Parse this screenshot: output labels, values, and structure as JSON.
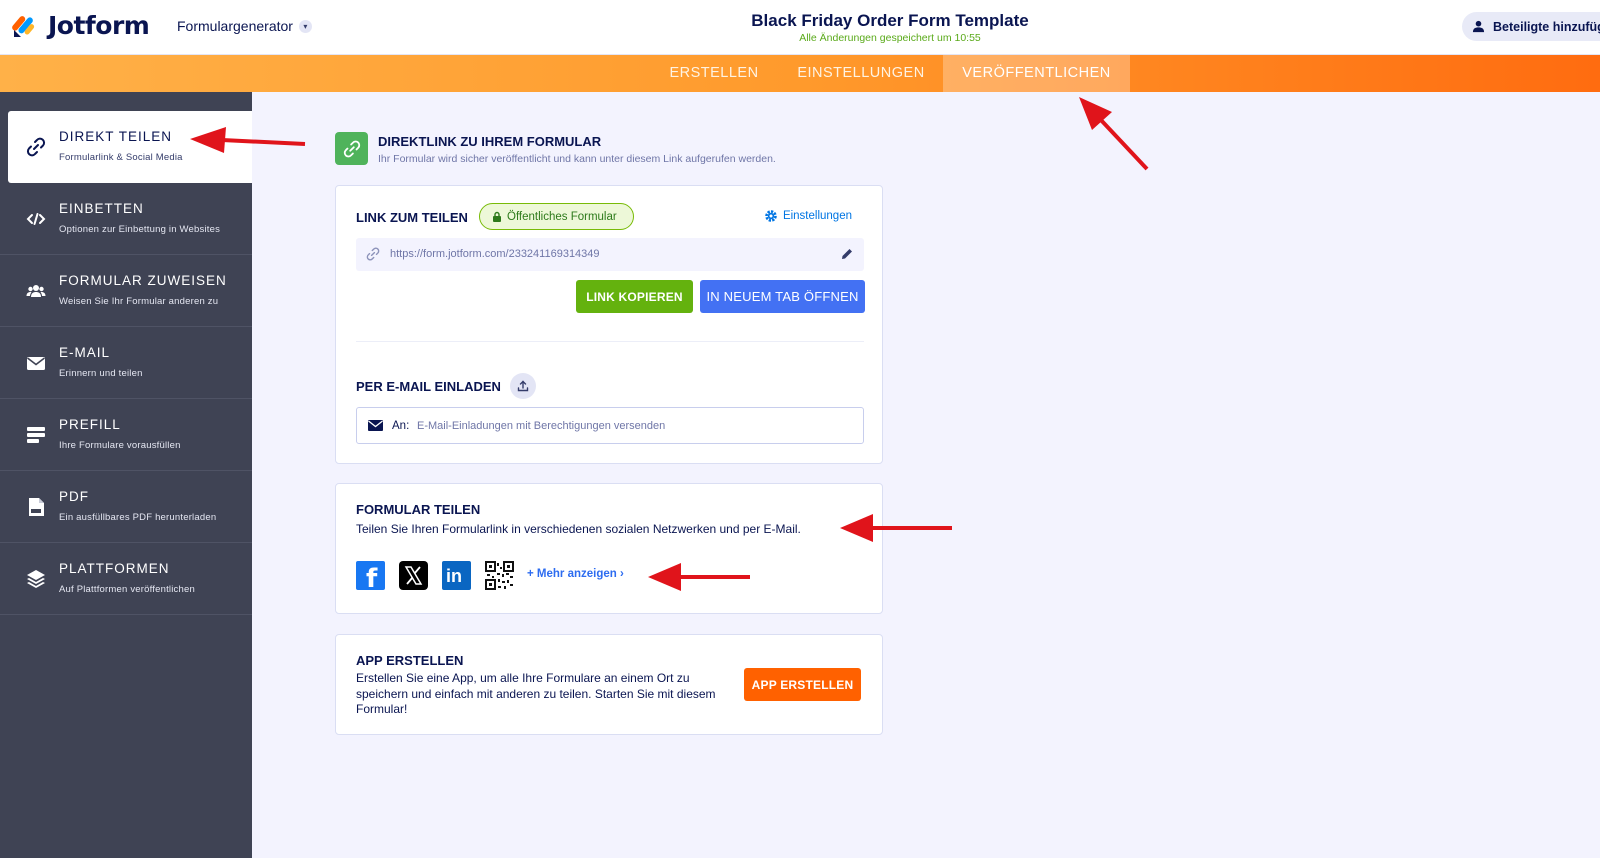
{
  "header": {
    "logo_text": "Jotform",
    "builder_label": "Formulargenerator",
    "form_title": "Black Friday Order Form Template",
    "save_status": "Alle Änderungen gespeichert um 10:55",
    "collaborators_label": "Beteiligte hinzufügen"
  },
  "tabs": [
    {
      "label": "ERSTELLEN",
      "active": false
    },
    {
      "label": "EINSTELLUNGEN",
      "active": false
    },
    {
      "label": "VERÖFFENTLICHEN",
      "active": true
    }
  ],
  "sidebar": {
    "items": [
      {
        "title": "DIREKT TEILEN",
        "subtitle": "Formularlink & Social Media",
        "icon": "link-icon",
        "active": true
      },
      {
        "title": "EINBETTEN",
        "subtitle": "Optionen zur Einbettung in Websites",
        "icon": "code-icon",
        "active": false
      },
      {
        "title": "FORMULAR ZUWEISEN",
        "subtitle": "Weisen Sie Ihr Formular anderen zu",
        "icon": "users-icon",
        "active": false
      },
      {
        "title": "E-MAIL",
        "subtitle": "Erinnern und teilen",
        "icon": "envelope-icon",
        "active": false
      },
      {
        "title": "PREFILL",
        "subtitle": "Ihre Formulare vorausfüllen",
        "icon": "prefill-icon",
        "active": false
      },
      {
        "title": "PDF",
        "subtitle": "Ein ausfüllbares PDF herunterladen",
        "icon": "pdf-icon",
        "active": false
      },
      {
        "title": "PLATTFORMEN",
        "subtitle": "Auf Plattformen veröffentlichen",
        "icon": "layers-icon",
        "active": false
      }
    ]
  },
  "main": {
    "heading": "DIREKTLINK ZU IHREM FORMULAR",
    "subheading": "Ihr Formular wird sicher veröffentlicht und kann unter diesem Link aufgerufen werden.",
    "link_card": {
      "title": "LINK ZUM TEILEN",
      "badge": "Öffentliches Formular",
      "settings_link": "Einstellungen",
      "url": "https://form.jotform.com/233241169314349",
      "copy_button": "LINK KOPIEREN",
      "open_button": "IN NEUEM TAB ÖFFNEN",
      "invite_title": "PER E-MAIL EINLADEN",
      "email_to_label": "An:",
      "email_placeholder": "E-Mail-Einladungen mit Berechtigungen versenden"
    },
    "share_card": {
      "title": "FORMULAR TEILEN",
      "description": "Teilen Sie Ihren Formularlink in verschiedenen sozialen Netzwerken und per E-Mail.",
      "more_link": "+ Mehr anzeigen ›",
      "facebook_letter": "f",
      "linkedin_letter": "in"
    },
    "app_card": {
      "title": "APP ERSTELLEN",
      "description": "Erstellen Sie eine App, um alle Ihre Formulare an einem Ort zu speichern und einfach mit anderen zu teilen. Starten Sie mit diesem Formular!",
      "button": "APP ERSTELLEN"
    }
  },
  "colors": {
    "accent_orange": "#ff6100",
    "tab_gradient_start": "#ffb148",
    "tab_gradient_end": "#ff6c10",
    "sidebar_bg": "#3f4354",
    "green_button": "#64b20e",
    "blue_button": "#4371f3",
    "annotation_arrow": "#e0141b"
  }
}
